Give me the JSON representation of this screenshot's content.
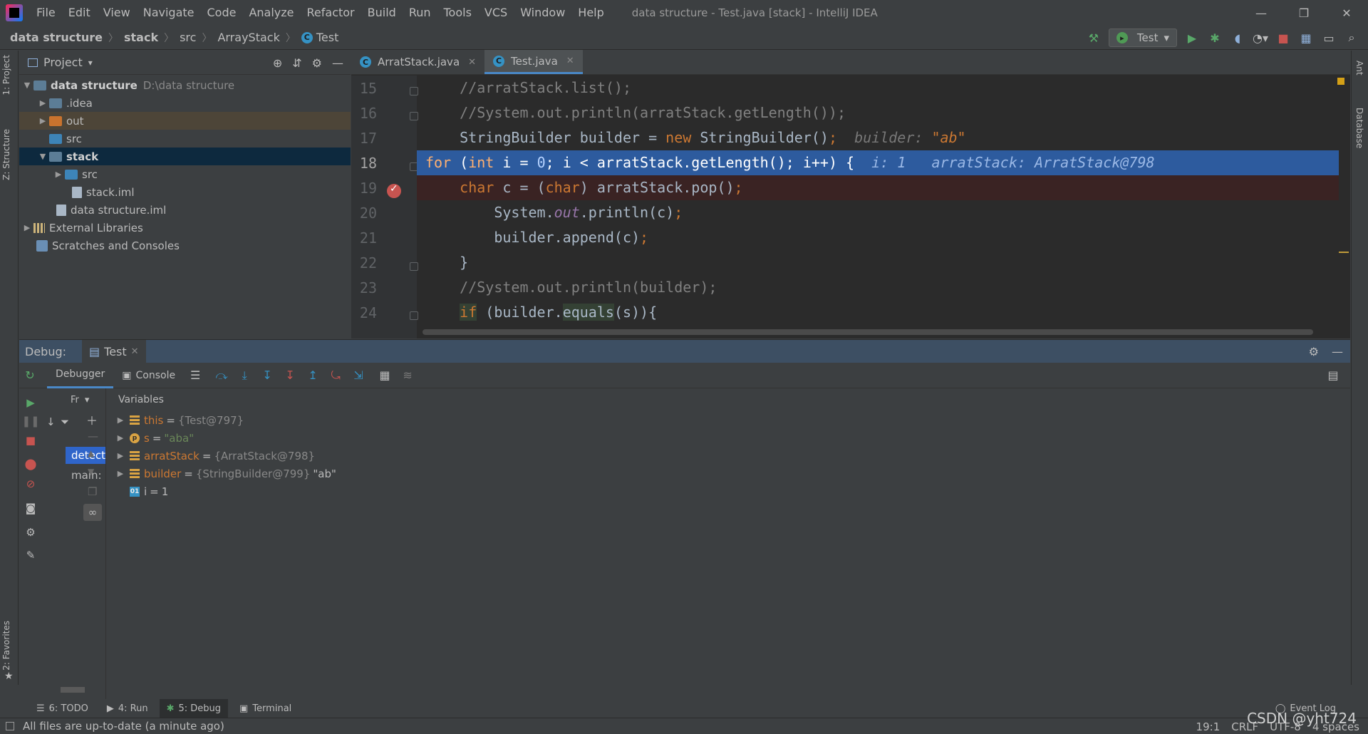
{
  "window": {
    "title": "data structure - Test.java [stack] - IntelliJ IDEA",
    "controls": [
      "—",
      "❐",
      "✕"
    ]
  },
  "menu": [
    "File",
    "Edit",
    "View",
    "Navigate",
    "Code",
    "Analyze",
    "Refactor",
    "Build",
    "Run",
    "Tools",
    "VCS",
    "Window",
    "Help"
  ],
  "breadcrumb": [
    "data structure",
    "stack",
    "src",
    "ArrayStack",
    "Test"
  ],
  "run_config": {
    "label": "Test"
  },
  "left_strip": {
    "project_tab": "1: Project",
    "structure_tab": "Z: Structure",
    "favorites_tab": "2: Favorites"
  },
  "right_strip": {
    "ant_tab": "Ant",
    "database_tab": "Database"
  },
  "project": {
    "title": "Project",
    "root": {
      "name": "data structure",
      "path": "D:\\data structure"
    },
    "items": [
      ".idea",
      "out",
      "src",
      "stack",
      "src",
      "stack.iml",
      "data structure.iml",
      "External Libraries",
      "Scratches and Consoles"
    ]
  },
  "editor": {
    "tabs": [
      {
        "label": "ArratStack.java",
        "close": "✕"
      },
      {
        "label": "Test.java",
        "close": "✕"
      }
    ],
    "lines": {
      "l15": {
        "no": "15",
        "text": "    //arratStack.list();"
      },
      "l16": {
        "no": "16",
        "text": "    //System.out.println(arratStack.getLength());"
      },
      "l17": {
        "no": "17",
        "a": "    StringBuilder builder = ",
        "kw": "new",
        "b": " StringBuilder()",
        "semi": ";",
        "hint_name": "  builder: ",
        "hint_val": "\"ab\""
      },
      "l18": {
        "no": "18",
        "kw1": "for",
        "a": " (",
        "kw2": "int",
        "b": " i = ",
        "num": "0",
        "c": "; i < arratStack.getLength(); i++) {",
        "hint": "  i: 1   arratStack: ArratStack@798"
      },
      "l19": {
        "no": "19",
        "kw1": "char",
        "a": " c = (",
        "kw2": "char",
        "b": ") arratStack.pop()",
        "semi": ";"
      },
      "l20": {
        "no": "20",
        "a": "        System.",
        "fld": "out",
        "b": ".println(c)",
        "semi": ";"
      },
      "l21": {
        "no": "21",
        "a": "        builder.append(c)",
        "semi": ";"
      },
      "l22": {
        "no": "22",
        "text": "    }"
      },
      "l23": {
        "no": "23",
        "text": "    //System.out.println(builder);"
      },
      "l24": {
        "no": "24",
        "kw": "if",
        "a": " (builder.",
        "eq": "equals",
        "b": "(s)){"
      }
    }
  },
  "debug": {
    "label": "Debug:",
    "session": "Test",
    "tabs": {
      "debugger": "Debugger",
      "console": "Console"
    },
    "frames_selector": "Fr",
    "frames": [
      "detect",
      "main:"
    ],
    "variables_header": "Variables",
    "variables": [
      {
        "name": "this",
        "eq": "=",
        "type": "{Test@797}",
        "value": ""
      },
      {
        "name": "s",
        "eq": "=",
        "type": "",
        "value": "\"aba\""
      },
      {
        "name": "arratStack",
        "eq": "=",
        "type": "{ArratStack@798}",
        "value": ""
      },
      {
        "name": "builder",
        "eq": "=",
        "type": "{StringBuilder@799}",
        "value": "\"ab\""
      },
      {
        "name": "i",
        "eq": "=",
        "type": "",
        "value": "1"
      }
    ]
  },
  "bottom_tabs": [
    {
      "label": "6: TODO"
    },
    {
      "label": "4: Run"
    },
    {
      "label": "5: Debug"
    },
    {
      "label": "Terminal"
    }
  ],
  "event_log": "Event Log",
  "status": {
    "message": "All files are up-to-date (a minute ago)",
    "position": "19:1",
    "line_sep": "CRLF",
    "encoding": "UTF-8",
    "indent": "4 spaces"
  },
  "watermark": "CSDN @yht724",
  "colors": {
    "accent": "#4a88c7",
    "exec_line": "#2d5b9e",
    "breakpoint": "#c75450",
    "keyword": "#cc7832",
    "string": "#6a8759"
  }
}
